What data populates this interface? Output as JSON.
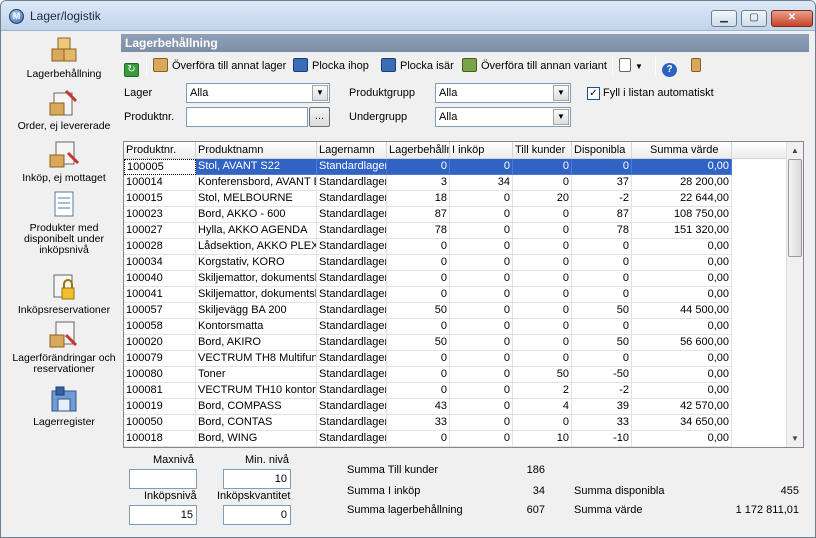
{
  "window": {
    "title": "Lager/logistik",
    "minimize": "▁",
    "maximize": "▢",
    "close": "✕"
  },
  "sidebar": {
    "items": [
      {
        "label": "Lagerbehållning",
        "icon": "boxes-icon"
      },
      {
        "label": "Order, ej levererade",
        "icon": "order-icon"
      },
      {
        "label": "Inköp, ej mottaget",
        "icon": "purchase-icon"
      },
      {
        "label": "Produkter med disponibelt under inköpsnivå",
        "icon": "document-icon"
      },
      {
        "label": "Inköpsreservationer",
        "icon": "lock-icon"
      },
      {
        "label": "Lagerförändringar och reservationer",
        "icon": "changes-icon"
      },
      {
        "label": "Lagerregister",
        "icon": "warehouse-icon"
      }
    ]
  },
  "header": {
    "title": "Lagerbehållning"
  },
  "toolbar": {
    "transfer_warehouse": "Överföra till annat lager",
    "pick_together": "Plocka ihop",
    "pick_apart": "Plocka isär",
    "transfer_variant": "Överföra till annan variant"
  },
  "filters": {
    "lager_label": "Lager",
    "lager_value": "Alla",
    "produktnr_label": "Produktnr.",
    "produktnr_value": "",
    "browse_button": "...",
    "produktgrupp_label": "Produktgrupp",
    "produktgrupp_value": "Alla",
    "undergrupp_label": "Undergrupp",
    "undergrupp_value": "Alla",
    "autofill_label": "Fyll i listan automatiskt",
    "autofill_checked": "✓"
  },
  "table": {
    "columns": [
      "Produktnr.",
      "Produktnamn",
      "Lagernamn",
      "Lagerbehålln",
      "I inköp",
      "Till kunder",
      "Disponibla",
      "Summa värde"
    ],
    "rows": [
      [
        "100005",
        "Stol, AVANT S22",
        "Standardlager",
        "0",
        "0",
        "0",
        "0",
        "0,00"
      ],
      [
        "100014",
        "Konferensbord, AVANT E",
        "Standardlager",
        "3",
        "34",
        "0",
        "37",
        "28 200,00"
      ],
      [
        "100015",
        "Stol, MELBOURNE",
        "Standardlager",
        "18",
        "0",
        "20",
        "-2",
        "22 644,00"
      ],
      [
        "100023",
        "Bord, AKKO - 600",
        "Standardlager",
        "87",
        "0",
        "0",
        "87",
        "108 750,00"
      ],
      [
        "100027",
        "Hylla, AKKO AGENDA",
        "Standardlager",
        "78",
        "0",
        "0",
        "78",
        "151 320,00"
      ],
      [
        "100028",
        "Lådsektion, AKKO PLEX",
        "Standardlager",
        "0",
        "0",
        "0",
        "0",
        "0,00"
      ],
      [
        "100034",
        "Korgstativ, KORO",
        "Standardlager",
        "0",
        "0",
        "0",
        "0",
        "0,00"
      ],
      [
        "100040",
        "Skiljemattor, dokumentsk",
        "Standardlager",
        "0",
        "0",
        "0",
        "0",
        "0,00"
      ],
      [
        "100041",
        "Skiljemattor, dokumentsk",
        "Standardlager",
        "0",
        "0",
        "0",
        "0",
        "0,00"
      ],
      [
        "100057",
        "Skiljevägg BA 200",
        "Standardlager",
        "50",
        "0",
        "0",
        "50",
        "44 500,00"
      ],
      [
        "100058",
        "Kontorsmatta",
        "Standardlager",
        "0",
        "0",
        "0",
        "0",
        "0,00"
      ],
      [
        "100020",
        "Bord, AKIRO",
        "Standardlager",
        "50",
        "0",
        "0",
        "50",
        "56 600,00"
      ],
      [
        "100079",
        "VECTRUM TH8 Multifun",
        "Standardlager",
        "0",
        "0",
        "0",
        "0",
        "0,00"
      ],
      [
        "100080",
        "Toner",
        "Standardlager",
        "0",
        "0",
        "50",
        "-50",
        "0,00"
      ],
      [
        "100081",
        "VECTRUM TH10 kontors",
        "Standardlager",
        "0",
        "0",
        "2",
        "-2",
        "0,00"
      ],
      [
        "100019",
        "Bord, COMPASS",
        "Standardlager",
        "43",
        "0",
        "4",
        "39",
        "42 570,00"
      ],
      [
        "100050",
        "Bord, CONTAS",
        "Standardlager",
        "33",
        "0",
        "0",
        "33",
        "34 650,00"
      ],
      [
        "100018",
        "Bord, WING",
        "Standardlager",
        "0",
        "0",
        "10",
        "-10",
        "0,00"
      ]
    ]
  },
  "footer": {
    "maxniva_label": "Maxnivå",
    "maxniva_value": "",
    "minniva_label": "Min. nivå",
    "minniva_value": "10",
    "inkopsniva_label": "Inköpsnivå",
    "inkopsniva_value": "15",
    "inkopskvantitet_label": "Inköpskvantitet",
    "inkopskvantitet_value": "0",
    "summa_till_kunder_label": "Summa Till kunder",
    "summa_till_kunder_value": "186",
    "summa_i_inkop_label": "Summa I inköp",
    "summa_i_inkop_value": "34",
    "summa_lagerbehallning_label": "Summa lagerbehållning",
    "summa_lagerbehallning_value": "607",
    "summa_disponibla_label": "Summa disponibla",
    "summa_disponibla_value": "455",
    "summa_varde_label": "Summa värde",
    "summa_varde_value": "1 172 811,01"
  }
}
